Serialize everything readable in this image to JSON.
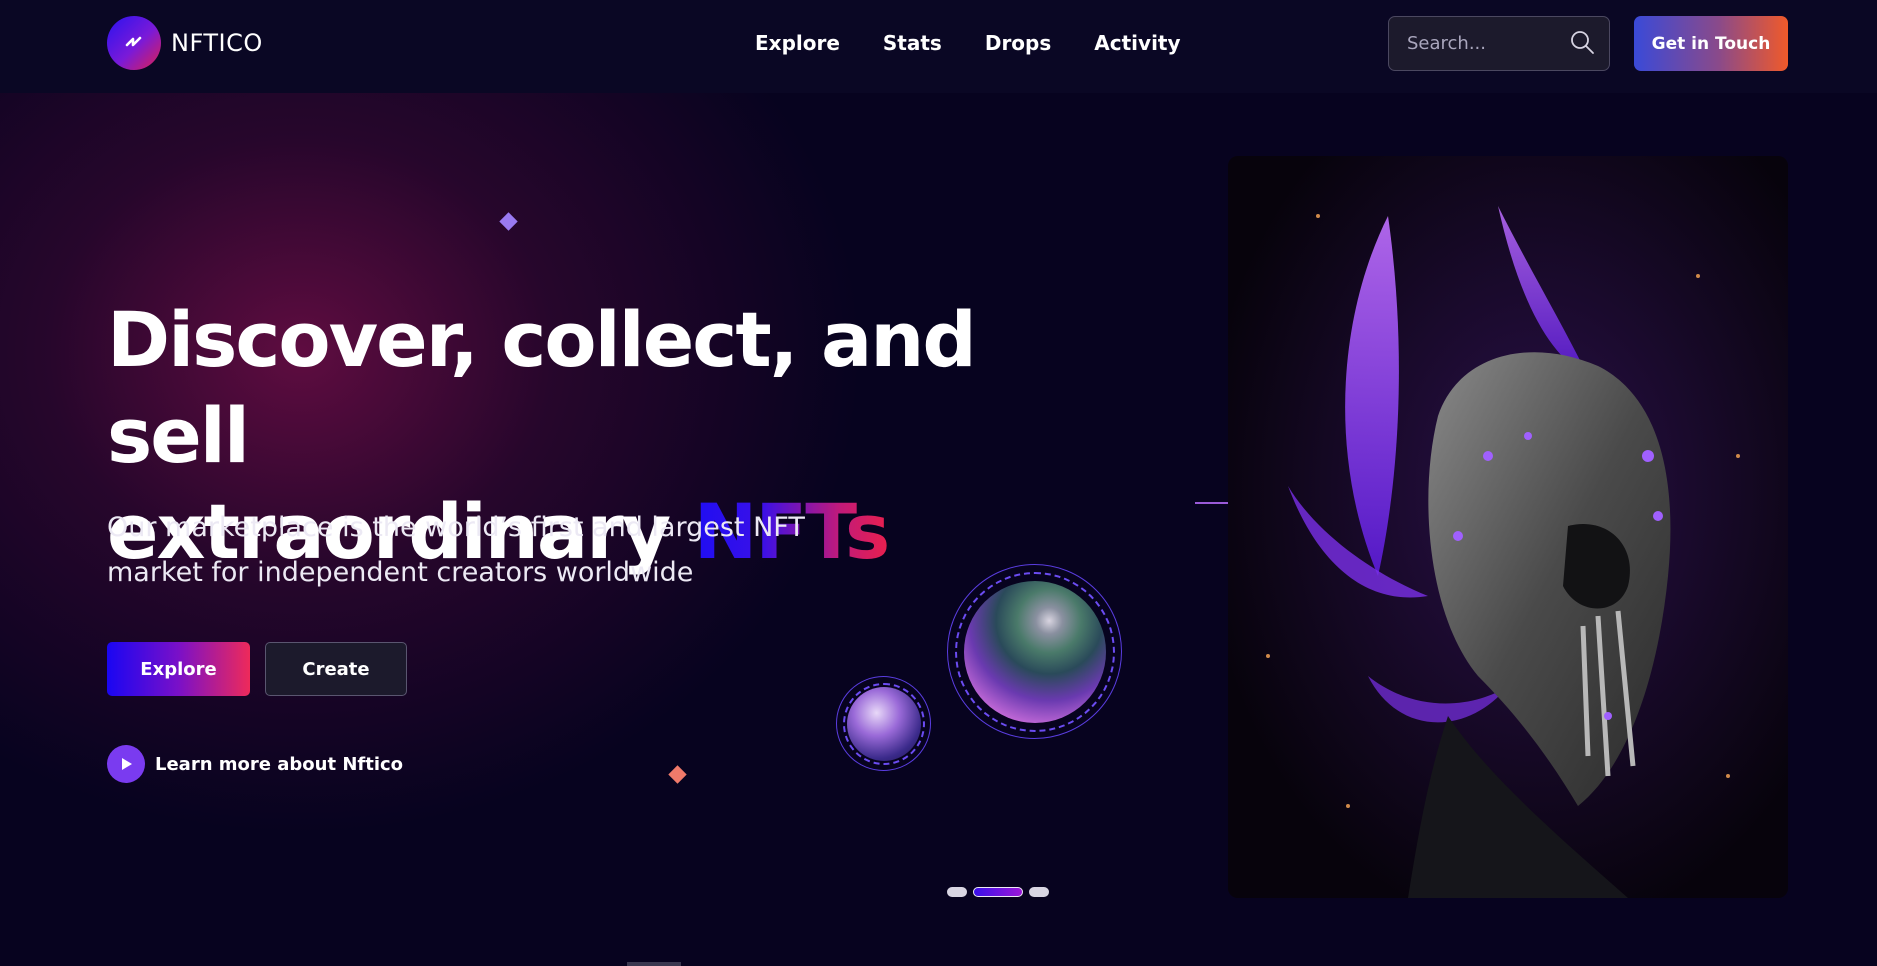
{
  "header": {
    "logo_text": "NFTICO",
    "nav": [
      "Explore",
      "Stats",
      "Drops",
      "Activity"
    ],
    "search_placeholder": "Search...",
    "cta_label": "Get in Touch"
  },
  "hero": {
    "headline_line1": "Discover, collect, and sell",
    "headline_line2_prefix": "extraordinary",
    "headline_accent": "NFTs",
    "subtitle_line1": "Our marketplace is the world’s first and largest NFT",
    "subtitle_line2": "market for independent creators worldwide",
    "explore_label": "Explore",
    "create_label": "Create",
    "learn_more_label": "Learn more about Nftico"
  },
  "carousel": {
    "slide_count": 3,
    "active_index": 1
  },
  "icons": {
    "logo": "logo-slash-icon",
    "search": "search-icon",
    "play": "play-icon",
    "arrow": "arrow-right-icon"
  },
  "colors": {
    "background": "#07031f",
    "header": "#0a0724",
    "accent_blue": "#1f0ef2",
    "accent_pink": "#e8204e",
    "accent_purple": "#7a3bf0"
  }
}
